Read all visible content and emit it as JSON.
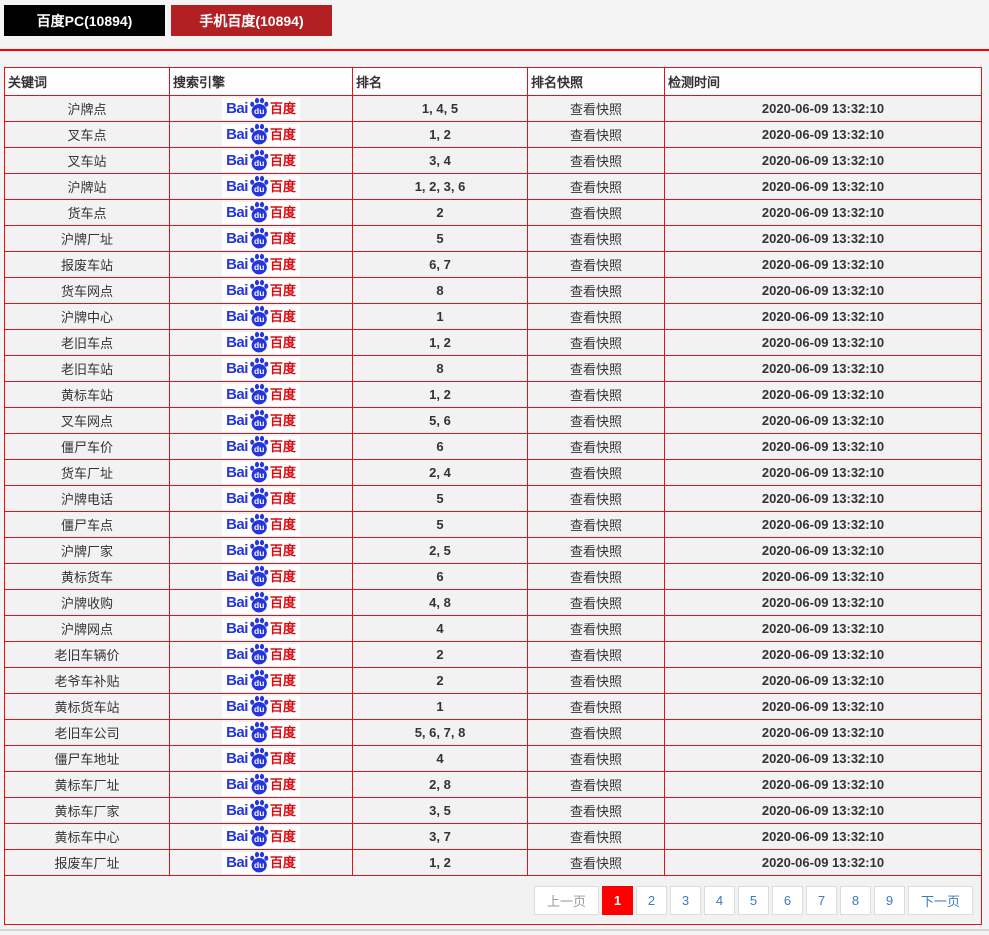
{
  "tabs": [
    {
      "id": "baidu-pc",
      "label": "百度PC(10894)",
      "active": false
    },
    {
      "id": "baidu-mobile",
      "label": "手机百度(10894)",
      "active": true
    }
  ],
  "table": {
    "headers": [
      "关键词",
      "搜索引擎",
      "排名",
      "排名快照",
      "检测时间"
    ],
    "engine": {
      "name": "百度",
      "logo_bai": "Bai",
      "logo_du": "du",
      "logo_cn": "百度"
    },
    "rows": [
      {
        "keyword": "沪牌点",
        "rank": "1, 4, 5",
        "snapshot": "查看快照",
        "time": "2020-06-09 13:32:10"
      },
      {
        "keyword": "叉车点",
        "rank": "1, 2",
        "snapshot": "查看快照",
        "time": "2020-06-09 13:32:10"
      },
      {
        "keyword": "叉车站",
        "rank": "3, 4",
        "snapshot": "查看快照",
        "time": "2020-06-09 13:32:10"
      },
      {
        "keyword": "沪牌站",
        "rank": "1, 2, 3, 6",
        "snapshot": "查看快照",
        "time": "2020-06-09 13:32:10"
      },
      {
        "keyword": "货车点",
        "rank": "2",
        "snapshot": "查看快照",
        "time": "2020-06-09 13:32:10"
      },
      {
        "keyword": "沪牌厂址",
        "rank": "5",
        "snapshot": "查看快照",
        "time": "2020-06-09 13:32:10"
      },
      {
        "keyword": "报废车站",
        "rank": "6, 7",
        "snapshot": "查看快照",
        "time": "2020-06-09 13:32:10"
      },
      {
        "keyword": "货车网点",
        "rank": "8",
        "snapshot": "查看快照",
        "time": "2020-06-09 13:32:10"
      },
      {
        "keyword": "沪牌中心",
        "rank": "1",
        "snapshot": "查看快照",
        "time": "2020-06-09 13:32:10"
      },
      {
        "keyword": "老旧车点",
        "rank": "1, 2",
        "snapshot": "查看快照",
        "time": "2020-06-09 13:32:10"
      },
      {
        "keyword": "老旧车站",
        "rank": "8",
        "snapshot": "查看快照",
        "time": "2020-06-09 13:32:10"
      },
      {
        "keyword": "黄标车站",
        "rank": "1, 2",
        "snapshot": "查看快照",
        "time": "2020-06-09 13:32:10"
      },
      {
        "keyword": "叉车网点",
        "rank": "5, 6",
        "snapshot": "查看快照",
        "time": "2020-06-09 13:32:10"
      },
      {
        "keyword": "僵尸车价",
        "rank": "6",
        "snapshot": "查看快照",
        "time": "2020-06-09 13:32:10"
      },
      {
        "keyword": "货车厂址",
        "rank": "2, 4",
        "snapshot": "查看快照",
        "time": "2020-06-09 13:32:10"
      },
      {
        "keyword": "沪牌电话",
        "rank": "5",
        "snapshot": "查看快照",
        "time": "2020-06-09 13:32:10"
      },
      {
        "keyword": "僵尸车点",
        "rank": "5",
        "snapshot": "查看快照",
        "time": "2020-06-09 13:32:10"
      },
      {
        "keyword": "沪牌厂家",
        "rank": "2, 5",
        "snapshot": "查看快照",
        "time": "2020-06-09 13:32:10"
      },
      {
        "keyword": "黄标货车",
        "rank": "6",
        "snapshot": "查看快照",
        "time": "2020-06-09 13:32:10"
      },
      {
        "keyword": "沪牌收购",
        "rank": "4, 8",
        "snapshot": "查看快照",
        "time": "2020-06-09 13:32:10"
      },
      {
        "keyword": "沪牌网点",
        "rank": "4",
        "snapshot": "查看快照",
        "time": "2020-06-09 13:32:10"
      },
      {
        "keyword": "老旧车辆价",
        "rank": "2",
        "snapshot": "查看快照",
        "time": "2020-06-09 13:32:10"
      },
      {
        "keyword": "老爷车补贴",
        "rank": "2",
        "snapshot": "查看快照",
        "time": "2020-06-09 13:32:10"
      },
      {
        "keyword": "黄标货车站",
        "rank": "1",
        "snapshot": "查看快照",
        "time": "2020-06-09 13:32:10"
      },
      {
        "keyword": "老旧车公司",
        "rank": "5, 6, 7, 8",
        "snapshot": "查看快照",
        "time": "2020-06-09 13:32:10"
      },
      {
        "keyword": "僵尸车地址",
        "rank": "4",
        "snapshot": "查看快照",
        "time": "2020-06-09 13:32:10"
      },
      {
        "keyword": "黄标车厂址",
        "rank": "2, 8",
        "snapshot": "查看快照",
        "time": "2020-06-09 13:32:10"
      },
      {
        "keyword": "黄标车厂家",
        "rank": "3, 5",
        "snapshot": "查看快照",
        "time": "2020-06-09 13:32:10"
      },
      {
        "keyword": "黄标车中心",
        "rank": "3, 7",
        "snapshot": "查看快照",
        "time": "2020-06-09 13:32:10"
      },
      {
        "keyword": "报废车厂址",
        "rank": "1, 2",
        "snapshot": "查看快照",
        "time": "2020-06-09 13:32:10"
      }
    ]
  },
  "pagination": {
    "prev_label": "上一页",
    "next_label": "下一页",
    "pages": [
      "1",
      "2",
      "3",
      "4",
      "5",
      "6",
      "7",
      "8",
      "9"
    ],
    "active": "1"
  },
  "colors": {
    "tab_pc_bg": "#000000",
    "tab_mobile_bg": "#b22024",
    "divider_red": "#ff0000",
    "table_border": "#e0121a",
    "row_bg": "#f2f2f2",
    "header_bg": "#ffffff",
    "page_bg": "#f4f4f4",
    "pager_link_blue": "#3b7cbc",
    "pager_prev_gray": "#9a9a9a",
    "active_page_bg": "#ff0000",
    "baidu_blue": "#2436dc",
    "baidu_red": "#dd0a12"
  }
}
